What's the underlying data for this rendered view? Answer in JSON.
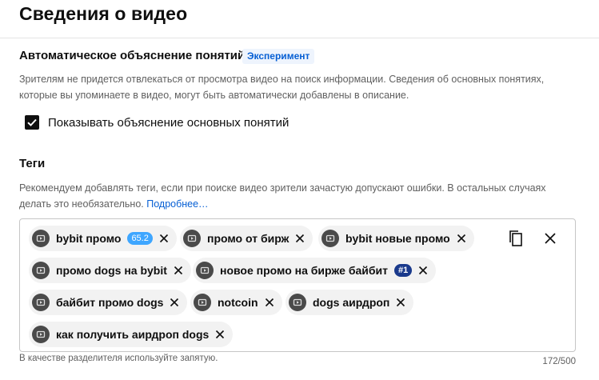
{
  "page": {
    "title": "Сведения о видео"
  },
  "concepts": {
    "heading": "Автоматическое объяснение понятий",
    "badge": "Эксперимент",
    "description": "Зрителям не придется отвлекаться от просмотра видео на поиск информации. Сведения об основных понятиях, которые вы упоминаете в видео, могут быть автоматически добавлены в описание.",
    "checkbox_label": "Показывать объяснение основных понятий",
    "checkbox_checked": true
  },
  "tags": {
    "heading": "Теги",
    "description": "Рекомендуем добавлять теги, если при поиске видео зрители зачастую допускают ошибки. В остальных случаях делать это необязательно.",
    "more_link": "Подробнее…",
    "items": [
      {
        "label": "bybit промо",
        "score": "65.2"
      },
      {
        "label": "промо от бирж"
      },
      {
        "label": "bybit новые промо"
      },
      {
        "label": "промо dogs на bybit"
      },
      {
        "label": "новое промо на бирже байбит",
        "rank": "#1"
      },
      {
        "label": "байбит промо dogs"
      },
      {
        "label": "notcoin"
      },
      {
        "label": "dogs аирдроп"
      },
      {
        "label": "как получить аирдроп dogs"
      }
    ],
    "hint": "В качестве разделителя используйте запятую.",
    "counter": "172/500"
  },
  "icons": {
    "tag_avatar": "tag-source-icon",
    "remove": "close-icon",
    "copy": "copy-icon",
    "clear": "clear-all-icon"
  },
  "colors": {
    "accent": "#065fd4",
    "badge_bg": "#eef4fd",
    "chip_bg": "#f2f2f2",
    "score_badge": "#3ea6ff",
    "rank_badge": "#1a3a8c"
  }
}
